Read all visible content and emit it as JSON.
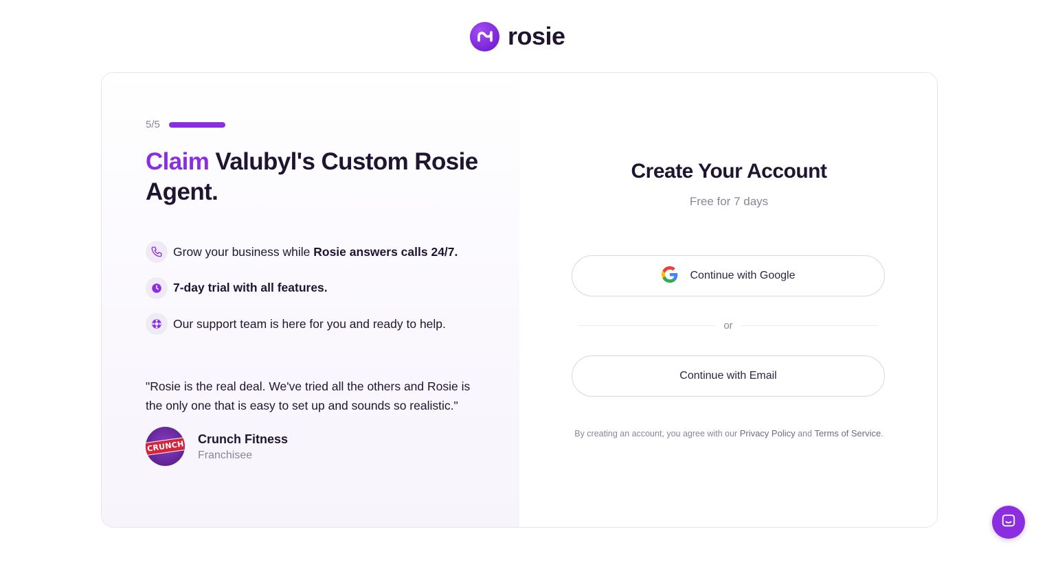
{
  "brand": {
    "name": "rosie",
    "accent_color": "#8b2ee0"
  },
  "left": {
    "progress": {
      "label": "5/5",
      "fraction": 1.0
    },
    "headline": {
      "accent": "Claim",
      "rest": " Valubyl's Custom Rosie Agent."
    },
    "features": [
      {
        "icon": "phone-icon",
        "text": "Grow your business while ",
        "bold": "Rosie answers calls 24/7."
      },
      {
        "icon": "clock-icon",
        "text": "",
        "bold": "7-day trial with all features."
      },
      {
        "icon": "lifebuoy-icon",
        "text": "Our support team is here for you and ready to help.",
        "bold": ""
      }
    ],
    "testimonial": {
      "quote": "\"Rosie is the real deal. We've tried all the others and Rosie is the only one that is easy to set up and sounds so realistic.\"",
      "author_name": "Crunch Fitness",
      "author_role": "Franchisee",
      "avatar_text": "CRUNCH"
    }
  },
  "right": {
    "title": "Create Your Account",
    "subtitle": "Free for 7 days",
    "google_button": "Continue with Google",
    "divider": "or",
    "email_button": "Continue with Email",
    "terms": {
      "prefix": "By creating an account, you agree with our",
      "privacy": "Privacy Policy",
      "and": "and",
      "tos": "Terms of Service",
      "suffix": "."
    }
  },
  "chat": {
    "icon": "chat-icon"
  }
}
